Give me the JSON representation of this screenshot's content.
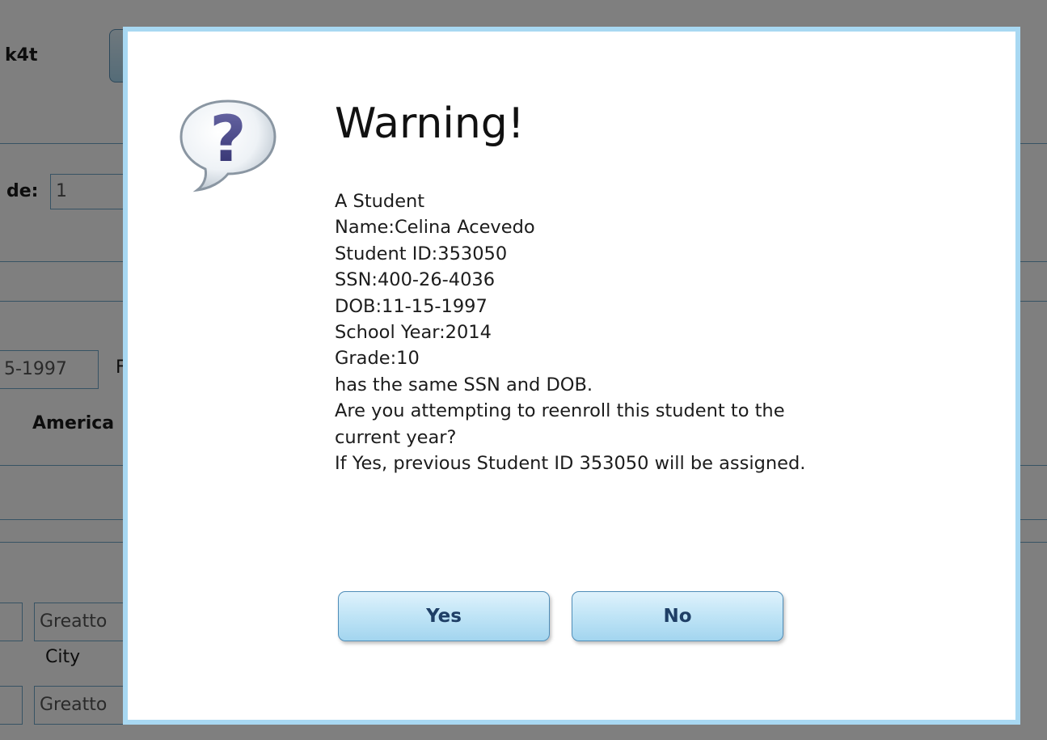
{
  "background": {
    "header_fragment": "k4t",
    "grade_label": "de:",
    "grade_value": "1",
    "dob_value": "5-1997",
    "letter_fragment": "F",
    "ethnicity_fragment": "America",
    "city_value_1": "Greatto",
    "city_label": "City",
    "city_value_2": "Greatto"
  },
  "dialog": {
    "icon": "question-mark-icon",
    "title": "Warning!",
    "message_lines": [
      "A Student",
      "Name:Celina Acevedo",
      "Student ID:353050",
      "SSN:400-26-4036",
      "DOB:11-15-1997",
      "School Year:2014",
      "Grade:10",
      "has the same SSN and DOB.",
      "Are you attempting to reenroll this student to the",
      "current year?",
      "If Yes, previous Student ID 353050 will be assigned."
    ],
    "yes_label": "Yes",
    "no_label": "No"
  },
  "colors": {
    "overlay": "#7b7b7b",
    "dialog_border": "#a8d8f2",
    "button_text": "#1f3f66",
    "accent_line": "#6ea6c8"
  }
}
